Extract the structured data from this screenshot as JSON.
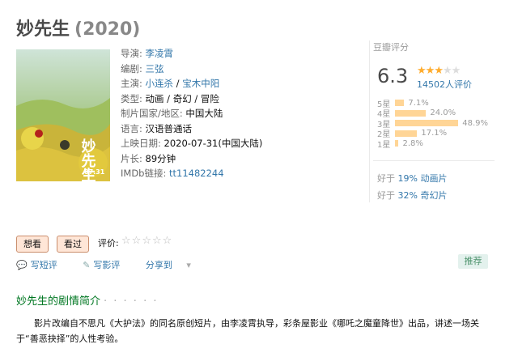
{
  "movie": {
    "title": "妙先生",
    "year": "(2020)"
  },
  "info": {
    "director_label": "导演:",
    "director": "李凌霄",
    "writer_label": "编剧:",
    "writer": "三弦",
    "cast_label": "主演:",
    "cast": [
      "小连杀",
      "宝木中阳"
    ],
    "genre_label": "类型:",
    "genre": "动画 / 奇幻 / 冒险",
    "country_label": "制片国家/地区:",
    "country": "中国大陆",
    "language_label": "语言:",
    "language": "汉语普通话",
    "release_label": "上映日期:",
    "release": "2020-07-31(中国大陆)",
    "runtime_label": "片长:",
    "runtime": "89分钟",
    "imdb_label": "IMDb链接:",
    "imdb": "tt11482244"
  },
  "rating": {
    "label": "豆瓣评分",
    "score": "6.3",
    "stars_filled": 3,
    "stars_total": 5,
    "count": "14502人评价",
    "breakdown": [
      {
        "label": "5星",
        "pct": "7.1%",
        "value": 7.1
      },
      {
        "label": "4星",
        "pct": "24.0%",
        "value": 24.0
      },
      {
        "label": "3星",
        "pct": "48.9%",
        "value": 48.9
      },
      {
        "label": "2星",
        "pct": "17.1%",
        "value": 17.1
      },
      {
        "label": "1星",
        "pct": "2.8%",
        "value": 2.8
      }
    ],
    "better_than": [
      {
        "prefix": "好于",
        "value": "19%",
        "category": "动画片"
      },
      {
        "prefix": "好于",
        "value": "32%",
        "category": "奇幻片"
      }
    ]
  },
  "actions": {
    "want": "想看",
    "seen": "看过",
    "rate_label": "评价:",
    "write_short": "写短评",
    "write_review": "写影评",
    "share": "分享到",
    "recommend": "推荐"
  },
  "intro": {
    "title": "妙先生的剧情简介",
    "dots": "· · · · · ·",
    "text": "影片改编自不思凡《大护法》的同名原创短片，由李凌霄执导，彩条屋影业《哪吒之魔童降世》出品，讲述一场关于“善恶抉择”的人性考验。"
  },
  "poster": {
    "caption": "妙先生",
    "date": "07.31"
  }
}
